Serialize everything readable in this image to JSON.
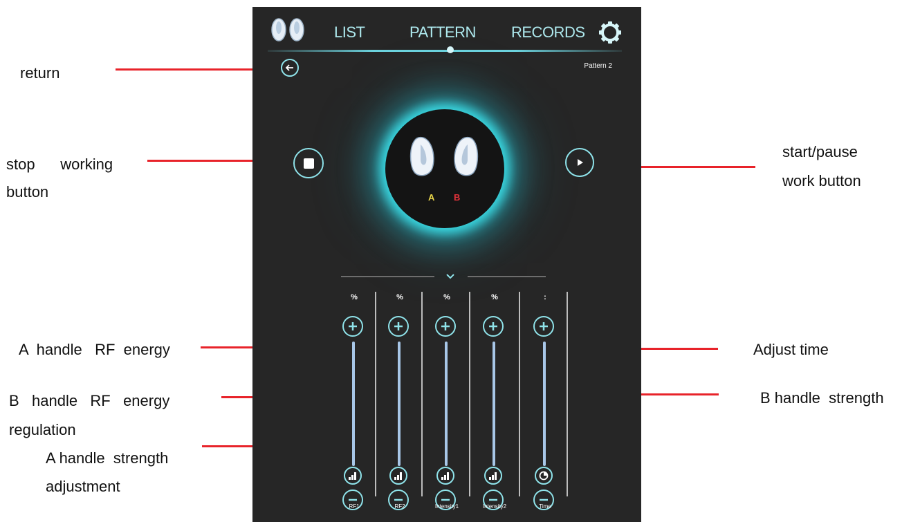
{
  "annotations": {
    "return": "return",
    "stop_line1": "stop      working",
    "stop_line2": "button",
    "start_line1": "start/pause",
    "start_line2": "work button",
    "a_rf": "A  handle   RF  energy",
    "b_rf_line1": "B   handle   RF   energy",
    "b_rf_line2": "regulation",
    "a_strength_line1": "A handle  strength",
    "a_strength_line2": "adjustment",
    "adjust_time": "Adjust time",
    "b_strength": "B handle  strength"
  },
  "nav": {
    "tabs": [
      {
        "label": "LIST"
      },
      {
        "label": "PATTERN",
        "active": true
      },
      {
        "label": "RECORDS"
      }
    ]
  },
  "pattern_name": "Pattern 2",
  "handles": {
    "a": "A",
    "b": "B"
  },
  "colors": {
    "accent": "#6cd3de",
    "background": "#262626",
    "handle_a": "#e9d64a",
    "handle_b": "#e2323a",
    "annotation_line": "#e8232a"
  },
  "sliders": [
    {
      "unit": "%",
      "label": "RF1",
      "bottom_icon": "signal-icon"
    },
    {
      "unit": "%",
      "label": "RF2",
      "bottom_icon": "signal-icon"
    },
    {
      "unit": "%",
      "label": "Intensity1",
      "bottom_icon": "signal-icon"
    },
    {
      "unit": "%",
      "label": "Intensity2",
      "bottom_icon": "signal-icon"
    },
    {
      "unit": ":",
      "label": "Time",
      "bottom_icon": "clock-icon"
    }
  ]
}
